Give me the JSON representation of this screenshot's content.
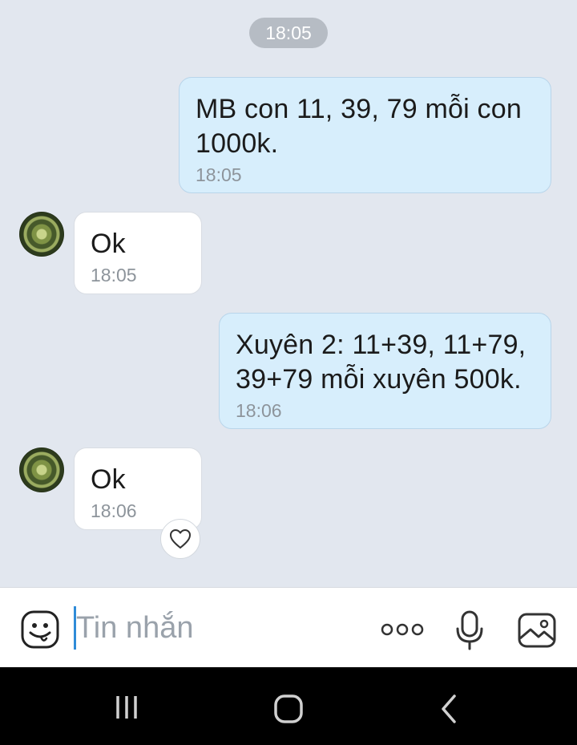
{
  "chat": {
    "date_time": "18:05",
    "messages": [
      {
        "direction": "out",
        "text": "MB con 11, 39, 79 mỗi con 1000k.",
        "time": "18:05"
      },
      {
        "direction": "in",
        "text": "Ok",
        "time": "18:05"
      },
      {
        "direction": "out",
        "text": "Xuyên 2: 11+39, 11+79, 39+79 mỗi xuyên 500k.",
        "time": "18:06"
      },
      {
        "direction": "in",
        "text": "Ok",
        "time": "18:06"
      }
    ]
  },
  "input": {
    "placeholder": "Tin nhắn"
  },
  "icons": {
    "sticker": "sticker-icon",
    "more": "more-icon",
    "mic": "microphone-icon",
    "image": "image-icon",
    "heart": "heart-icon",
    "recents": "recents-icon",
    "home": "home-icon",
    "back": "back-icon"
  },
  "colors": {
    "background": "#e2e7ef",
    "outgoing_bubble": "#d7eefc",
    "incoming_bubble": "#ffffff",
    "caret": "#2f8bd8"
  }
}
